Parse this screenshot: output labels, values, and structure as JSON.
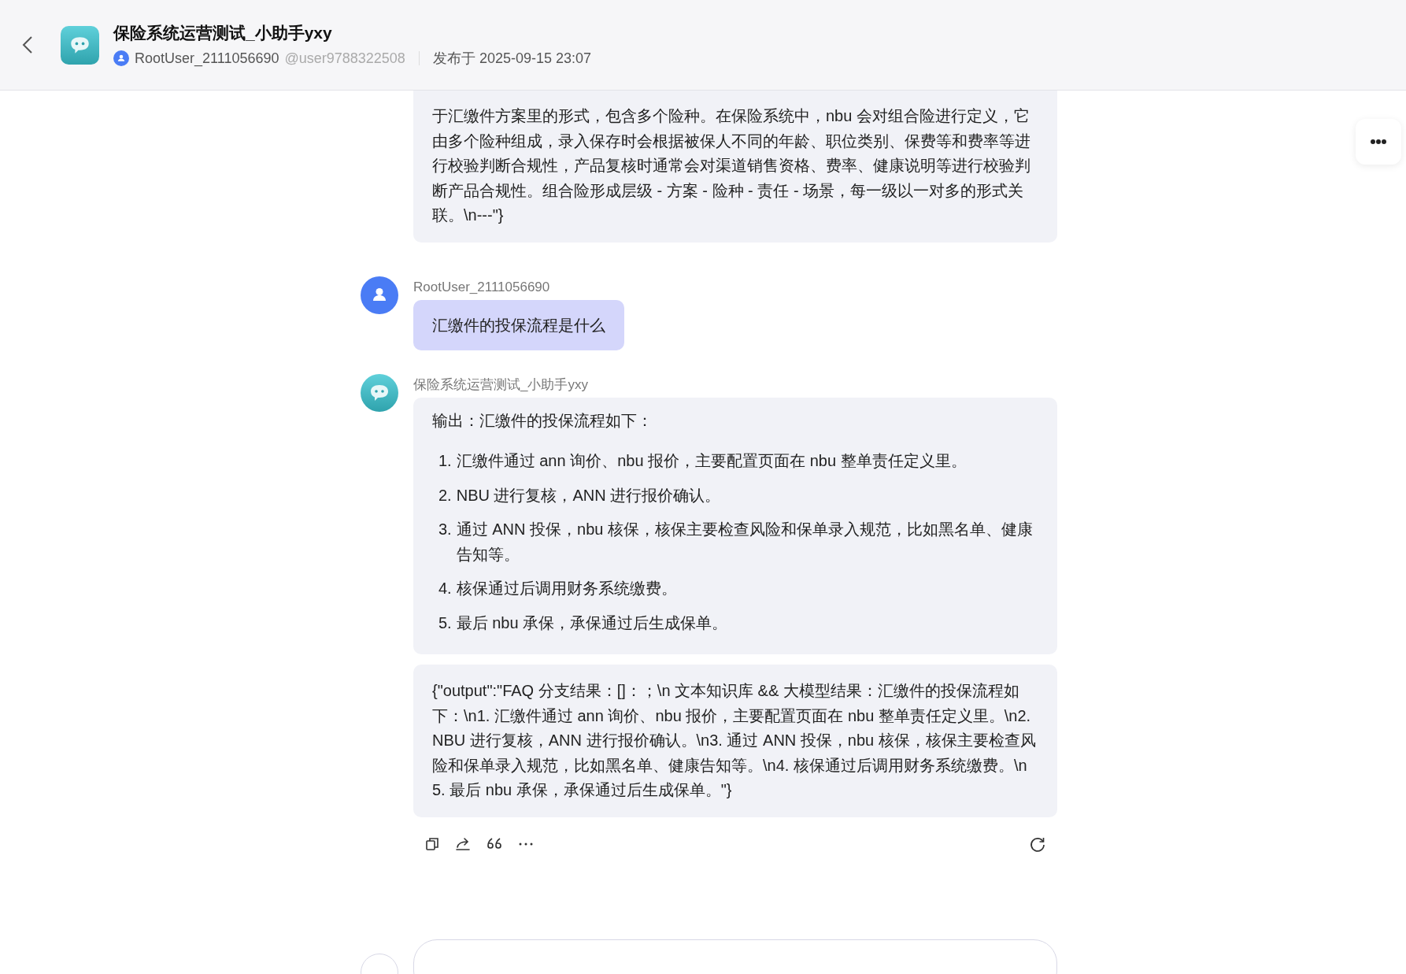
{
  "header": {
    "title": "保险系统运营测试_小助手yxy",
    "author": "RootUser_2111056690",
    "handle": "@user9788322508",
    "published": "发布于 2025-09-15 23:07"
  },
  "messages": [
    {
      "kind": "bot",
      "blocks": [
        {
          "kind": "text",
          "text": "于汇缴件方案里的形式，包含多个险种。在保险系统中，nbu 会对组合险进行定义，它由多个险种组成，录入保存时会根据被保人不同的年龄、职位类别、保费等和费率等进行校验判断合规性，产品复核时通常会对渠道销售资格、费率、健康说明等进行校验判断产品合规性。组合险形成层级 - 方案 - 险种 - 责任 - 场景，每一级以一对多的形式关联。\\n---\"}"
        }
      ]
    },
    {
      "kind": "user",
      "name": "RootUser_2111056690",
      "text": "汇缴件的投保流程是什么"
    },
    {
      "kind": "bot",
      "name": "保险系统运营测试_小助手yxy",
      "actions": true,
      "blocks": [
        {
          "kind": "list",
          "intro": "输出：汇缴件的投保流程如下：",
          "items": [
            {
              "number": "1.",
              "text": "汇缴件通过 ann 询价、nbu 报价，主要配置页面在 nbu 整单责任定义里。"
            },
            {
              "number": "2.",
              "text": "NBU 进行复核，ANN 进行报价确认。"
            },
            {
              "number": "3.",
              "text": "通过 ANN 投保，nbu 核保，核保主要检查风险和保单录入规范，比如黑名单、健康告知等。"
            },
            {
              "number": "4.",
              "text": "核保通过后调用财务系统缴费。"
            },
            {
              "number": "5.",
              "text": "最后 nbu 承保，承保通过后生成保单。"
            }
          ]
        },
        {
          "kind": "text",
          "text": "{\"output\":\"FAQ 分支结果：[]：；\\n 文本知识库 && 大模型结果：汇缴件的投保流程如下：\\n1. 汇缴件通过 ann 询价、nbu 报价，主要配置页面在 nbu 整单责任定义里。\\n2. NBU 进行复核，ANN 进行报价确认。\\n3. 通过 ANN 投保，nbu 核保，核保主要检查风险和保单录入规范，比如黑名单、健康告知等。\\n4. 核保通过后调用财务系统缴费。\\n5. 最后 nbu 承保，承保通过后生成保单。\"}"
        }
      ]
    }
  ]
}
